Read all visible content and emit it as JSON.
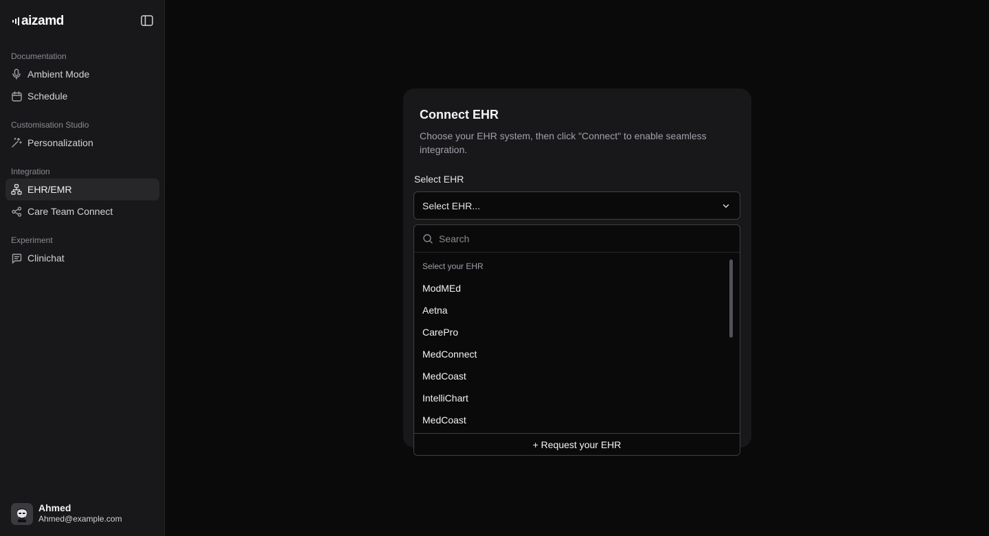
{
  "brand": {
    "name": "aizamd"
  },
  "sidebar": {
    "groups": [
      {
        "label": "Documentation",
        "items": [
          {
            "label": "Ambient Mode",
            "icon": "mic-icon"
          },
          {
            "label": "Schedule",
            "icon": "calendar-icon"
          }
        ]
      },
      {
        "label": "Customisation Studio",
        "items": [
          {
            "label": "Personalization",
            "icon": "magic-wand-icon"
          }
        ]
      },
      {
        "label": "Integration",
        "items": [
          {
            "label": "EHR/EMR",
            "icon": "network-icon",
            "active": true
          },
          {
            "label": "Care Team Connect",
            "icon": "share-icon"
          }
        ]
      },
      {
        "label": "Experiment",
        "items": [
          {
            "label": "Clinichat",
            "icon": "chat-icon"
          }
        ]
      }
    ],
    "user": {
      "name": "Ahmed",
      "email": "Ahmed@example.com"
    }
  },
  "card": {
    "title": "Connect EHR",
    "description": "Choose your EHR system, then click \"Connect\" to enable seamless integration.",
    "field_label": "Select EHR",
    "select_placeholder": "Select EHR..."
  },
  "dropdown": {
    "search_placeholder": "Search",
    "group_heading": "Select your EHR",
    "options": [
      "ModMEd",
      "Aetna",
      "CarePro",
      "MedConnect",
      "MedCoast",
      "IntelliChart",
      "MedCoast"
    ],
    "request_label": "+ Request your EHR"
  },
  "colors": {
    "background": "#0a0a0b",
    "sidebar": "#18181b",
    "card": "#18181b",
    "active_item": "#27272a",
    "border": "#3f3f46"
  }
}
